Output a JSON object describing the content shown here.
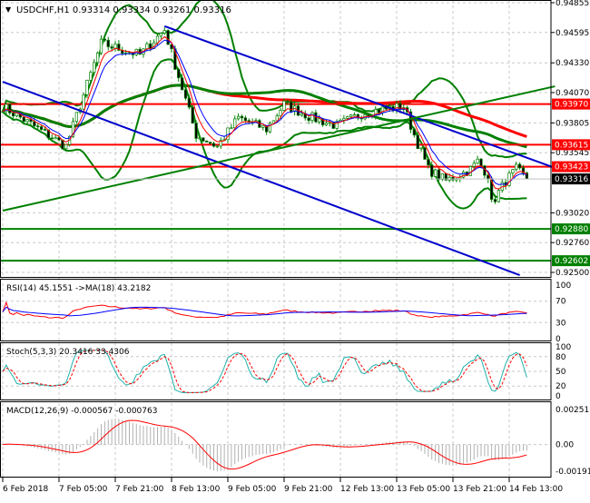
{
  "header": {
    "symbol": "USDCHF,H1",
    "open": "0.93314",
    "high": "0.93334",
    "low": "0.93261",
    "close": "0.93316"
  },
  "chart_data": {
    "type": "candlestick",
    "timeframe": "H1",
    "price_axis": {
      "min": 0.925,
      "max": 0.94855,
      "ticks": [
        "0.94855",
        "0.94595",
        "0.94330",
        "0.94070",
        "0.93805",
        "0.93545",
        "0.93020",
        "0.92760",
        "0.92500"
      ]
    },
    "time_labels": [
      "6 Feb 2018",
      "7 Feb 05:00",
      "7 Feb 21:00",
      "8 Feb 13:00",
      "9 Feb 05:00",
      "9 Feb 21:00",
      "12 Feb 13:00",
      "13 Feb 05:00",
      "13 Feb 21:00",
      "14 Feb 13:00"
    ],
    "close_path_bar_price": [
      [
        0,
        0.9395
      ],
      [
        18,
        0.936
      ],
      [
        28,
        0.945
      ],
      [
        39,
        0.944
      ],
      [
        46,
        0.9462
      ],
      [
        55,
        0.937
      ],
      [
        61,
        0.936
      ],
      [
        67,
        0.9385
      ],
      [
        75,
        0.9375
      ],
      [
        80,
        0.9397
      ],
      [
        88,
        0.9385
      ],
      [
        95,
        0.9378
      ],
      [
        103,
        0.939
      ],
      [
        114,
        0.9395
      ],
      [
        117,
        0.937
      ],
      [
        121,
        0.934
      ],
      [
        126,
        0.933
      ],
      [
        133,
        0.934
      ],
      [
        135,
        0.9347
      ],
      [
        138,
        0.9335
      ],
      [
        139,
        0.931
      ],
      [
        143,
        0.933
      ],
      [
        146,
        0.934
      ],
      [
        149,
        0.93316
      ]
    ],
    "levels": [
      {
        "price": "0.93970",
        "color": "#ff0000"
      },
      {
        "price": "0.93615",
        "color": "#ff0000"
      },
      {
        "price": "0.93423",
        "color": "#ff0000"
      },
      {
        "price": "0.92880",
        "color": "#008000"
      },
      {
        "price": "0.92602",
        "color": "#008000"
      }
    ],
    "current_price": "0.93316",
    "trendlines": [
      {
        "from": [
          46,
          0.9465
        ],
        "to": [
          157,
          0.93412
        ],
        "color": "#0000cc"
      },
      {
        "from": [
          0,
          0.94165
        ],
        "to": [
          147,
          0.92476
        ],
        "color": "#0000cc"
      },
      {
        "from": [
          0,
          0.93039
        ],
        "to": [
          157,
          0.94125
        ],
        "color": "#008000"
      }
    ],
    "indicators": {
      "rsi": {
        "label": "RSI(14) 45.1551  ->MA(18) 43.2182",
        "levels": [
          "100",
          "70",
          "30",
          "0"
        ]
      },
      "stoch": {
        "label": "Stoch(5,3,3) 20.3416 33.4306",
        "levels": [
          "100",
          "80",
          "50",
          "20",
          "0"
        ]
      },
      "macd": {
        "label": "MACD(12,26,9) -0.000567 -0.000763",
        "levels": [
          "0.00251",
          "0.00",
          "-0.001914"
        ]
      }
    },
    "colors": {
      "bull": "#008000",
      "bear": "#008000",
      "bands": "#008000",
      "ma_fast": "#0000ff",
      "ma_slow": "#ff0000",
      "stoch_main": "#20b2aa",
      "stoch_signal": "#ff0000"
    }
  }
}
